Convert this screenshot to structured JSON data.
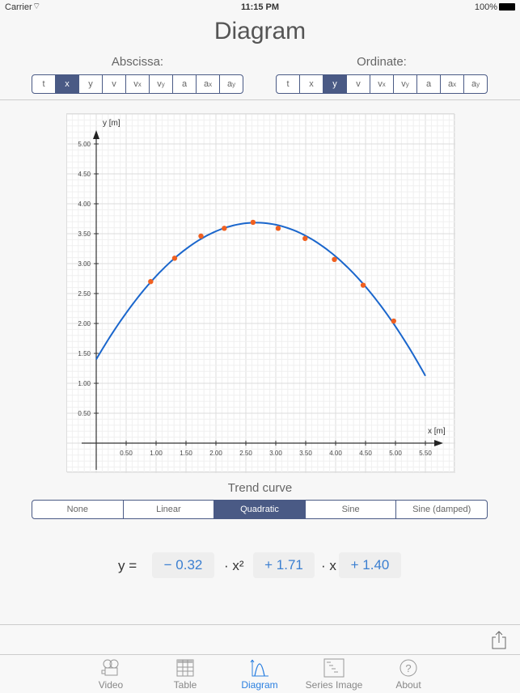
{
  "status": {
    "carrier": "Carrier",
    "time": "11:15 PM",
    "battery": "100%"
  },
  "header": {
    "title": "Diagram"
  },
  "abscissa": {
    "label": "Abscissa:",
    "options": [
      {
        "b": "t",
        "s": ""
      },
      {
        "b": "x",
        "s": ""
      },
      {
        "b": "y",
        "s": ""
      },
      {
        "b": "v",
        "s": ""
      },
      {
        "b": "v",
        "s": "x"
      },
      {
        "b": "v",
        "s": "y"
      },
      {
        "b": "a",
        "s": ""
      },
      {
        "b": "a",
        "s": "x"
      },
      {
        "b": "a",
        "s": "y"
      }
    ],
    "selected": 1
  },
  "ordinate": {
    "label": "Ordinate:",
    "options": [
      {
        "b": "t",
        "s": ""
      },
      {
        "b": "x",
        "s": ""
      },
      {
        "b": "y",
        "s": ""
      },
      {
        "b": "v",
        "s": ""
      },
      {
        "b": "v",
        "s": "x"
      },
      {
        "b": "v",
        "s": "y"
      },
      {
        "b": "a",
        "s": ""
      },
      {
        "b": "a",
        "s": "x"
      },
      {
        "b": "a",
        "s": "y"
      }
    ],
    "selected": 2
  },
  "chart_data": {
    "type": "scatter",
    "xlabel": "x [m]",
    "ylabel": "y [m]",
    "xlim": [
      0,
      5.5
    ],
    "ylim": [
      0,
      5
    ],
    "xticks": [
      "0.50",
      "1.00",
      "1.50",
      "2.00",
      "2.50",
      "3.00",
      "3.50",
      "4.00",
      "4.50",
      "5.00",
      "5.50"
    ],
    "yticks": [
      "0.50",
      "1.00",
      "1.50",
      "2.00",
      "2.50",
      "3.00",
      "3.50",
      "4.00",
      "4.50",
      "5.00"
    ],
    "grid": true,
    "points": [
      [
        0.91,
        2.7
      ],
      [
        1.31,
        3.09
      ],
      [
        1.75,
        3.46
      ],
      [
        2.14,
        3.59
      ],
      [
        2.62,
        3.69
      ],
      [
        3.04,
        3.59
      ],
      [
        3.49,
        3.42
      ],
      [
        3.98,
        3.07
      ],
      [
        4.46,
        2.64
      ],
      [
        4.97,
        2.04
      ]
    ],
    "fit": {
      "type": "quadratic",
      "a": -0.32,
      "b": 1.71,
      "c": 1.4,
      "xrange": [
        0,
        5.5
      ]
    },
    "point_color": "#f06020",
    "curve_color": "#1a66cc"
  },
  "trend": {
    "label": "Trend curve",
    "options": [
      "None",
      "Linear",
      "Quadratic",
      "Sine",
      "Sine (damped)"
    ],
    "selected": 2
  },
  "equation": {
    "lhs": "y =",
    "a": "− 0.32",
    "x2": "· x²",
    "b": "+ 1.71",
    "x": "· x",
    "c": "+ 1.40"
  },
  "tabbar": [
    {
      "label": "Video",
      "icon": "video-camera-icon"
    },
    {
      "label": "Table",
      "icon": "table-icon"
    },
    {
      "label": "Diagram",
      "icon": "diagram-icon"
    },
    {
      "label": "Series Image",
      "icon": "series-image-icon"
    },
    {
      "label": "About",
      "icon": "help-icon"
    }
  ],
  "accent": "#4a5a85"
}
